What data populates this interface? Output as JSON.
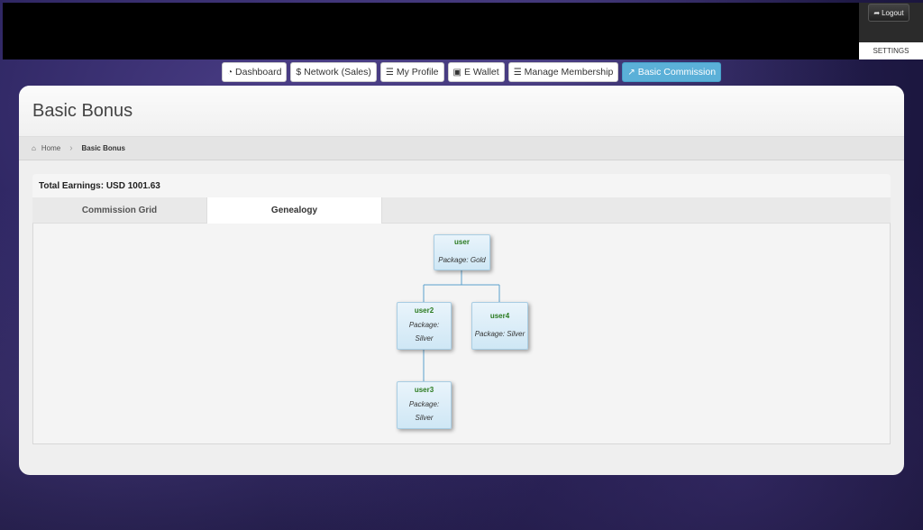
{
  "header": {
    "logout_label": "Logout",
    "settings_label": "SETTINGS"
  },
  "nav": {
    "items": [
      {
        "label": "Dashboard",
        "icon": "dashboard-icon"
      },
      {
        "label": "$ Network (Sales)",
        "icon": ""
      },
      {
        "label": "My Profile",
        "icon": "list-icon"
      },
      {
        "label": "E Wallet",
        "icon": "wallet-icon"
      },
      {
        "label": "Manage Membership",
        "icon": "list-icon"
      },
      {
        "label": "Basic Commission",
        "icon": "share-icon",
        "active": true
      }
    ]
  },
  "page": {
    "title": "Basic Bonus",
    "breadcrumb": {
      "home": "Home",
      "current": "Basic Bonus"
    },
    "total_earnings": "Total Earnings: USD 1001.63",
    "tabs": [
      {
        "label": "Commission Grid",
        "active": false
      },
      {
        "label": "Genealogy",
        "active": true
      }
    ]
  },
  "genealogy": {
    "nodes": [
      {
        "id": "user",
        "name": "user",
        "package_label": "Package:",
        "package": "Gold"
      },
      {
        "id": "user2",
        "name": "user2",
        "package_label": "Package:",
        "package": "Silver"
      },
      {
        "id": "user4",
        "name": "user4",
        "package_label": "Package:",
        "package": "Silver"
      },
      {
        "id": "user3",
        "name": "user3",
        "package_label": "Package:",
        "package": "Silver"
      }
    ]
  },
  "colors": {
    "active_nav": "#5bb0d8",
    "node_name": "#2a7a1f",
    "connector": "#5aa0cc"
  }
}
